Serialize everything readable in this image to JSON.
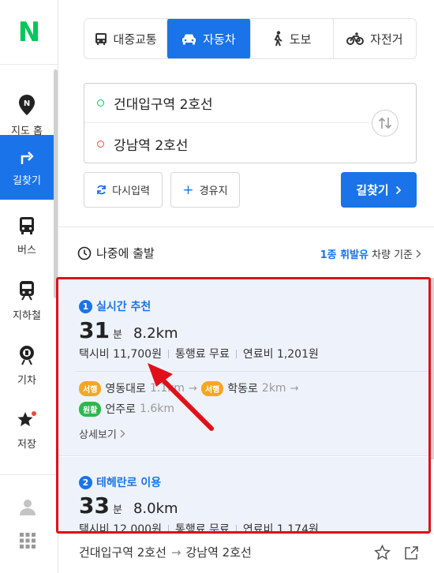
{
  "sidebar": {
    "logo": "N",
    "items": [
      {
        "label": "지도 홈",
        "icon": "map-pin-icon"
      },
      {
        "label": "길찾기",
        "icon": "directions-icon"
      },
      {
        "label": "버스",
        "icon": "bus-icon"
      },
      {
        "label": "지하철",
        "icon": "subway-icon"
      },
      {
        "label": "기차",
        "icon": "train-icon"
      },
      {
        "label": "저장",
        "icon": "star-icon"
      }
    ],
    "active_index": 1,
    "active_color": "#1a73e8",
    "logo_color": "#03c75a"
  },
  "modes": [
    {
      "label": "대중교통",
      "icon": "bus-icon"
    },
    {
      "label": "자동차",
      "icon": "car-icon"
    },
    {
      "label": "도보",
      "icon": "walk-icon"
    },
    {
      "label": "자전거",
      "icon": "bike-icon"
    }
  ],
  "route": {
    "start": "건대입구역 2호선",
    "end": "강남역 2호선"
  },
  "actions": {
    "reset": "다시입력",
    "waypoint": "경유지",
    "search": "길찾기"
  },
  "options": {
    "depart_later": "나중에 출발",
    "fuel_highlight": "1종 휘발유",
    "fuel_suffix": "차량 기준"
  },
  "results": [
    {
      "rank": "1",
      "title": "실시간 추천",
      "minutes": "31",
      "minute_unit": "분",
      "distance": "8.2km",
      "taxi": "택시비 11,700원",
      "toll": "통행료 무료",
      "fuel": "연료비 1,201원",
      "segments": [
        {
          "tag": "서행",
          "road": "영동대로",
          "dist": "1.1km"
        },
        {
          "tag": "서행",
          "road": "학동로",
          "dist": "2km"
        },
        {
          "tag": "원활",
          "road": "언주로",
          "dist": "1.6km"
        }
      ],
      "detail": "상세보기"
    },
    {
      "rank": "2",
      "title": "테헤란로 이용",
      "minutes": "33",
      "minute_unit": "분",
      "distance": "8.0km",
      "taxi": "택시비 12,000원",
      "toll": "통행료 무료",
      "fuel": "연료비 1,174원"
    }
  ],
  "footer": {
    "from": "건대입구역 2호선",
    "to": "강남역 2호선"
  },
  "colors": {
    "slow_tag": "#f5a623",
    "smooth_tag": "#2db74c",
    "annotation": "#e0101a"
  }
}
